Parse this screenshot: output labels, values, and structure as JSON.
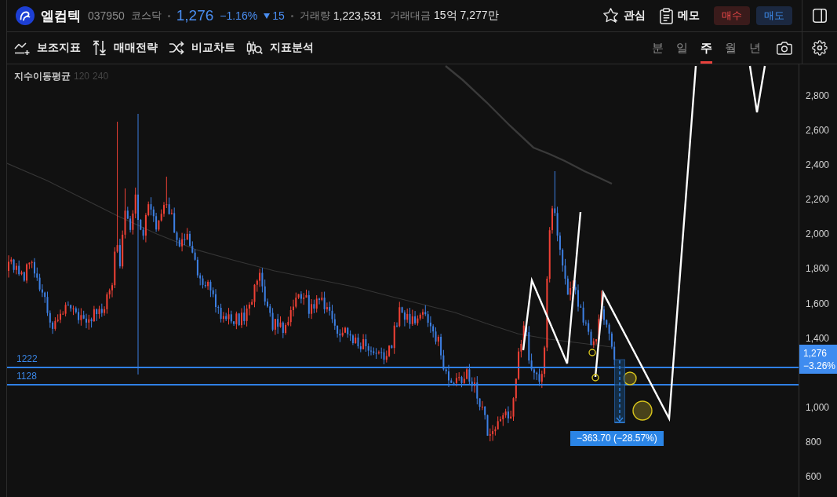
{
  "header": {
    "name": "엘컴텍",
    "code": "037950",
    "market": "코스닥",
    "price": "1,276",
    "change_percent": "−1.16%",
    "falling": true,
    "change_amount": "15",
    "volume_label": "거래량",
    "volume": "1,223,531",
    "trade_value_label": "거래대금",
    "trade_value": "15억 7,277만",
    "actions": [
      {
        "kind": "watchlist",
        "label": "관심"
      },
      {
        "kind": "memo",
        "label": "메모"
      }
    ],
    "order_buttons": [
      {
        "kind": "buy",
        "label": "매수"
      },
      {
        "kind": "sell",
        "label": "매도"
      }
    ]
  },
  "toolbar": {
    "tools": [
      {
        "kind": "indicators",
        "label": "보조지표"
      },
      {
        "kind": "strategy",
        "label": "매매전략"
      },
      {
        "kind": "compare",
        "label": "비교차트"
      },
      {
        "kind": "analysis",
        "label": "지표분석"
      }
    ],
    "timeframes": [
      {
        "label": "분",
        "selected": false
      },
      {
        "label": "일",
        "selected": false
      },
      {
        "label": "주",
        "selected": true
      },
      {
        "label": "월",
        "selected": false
      },
      {
        "label": "년",
        "selected": false
      }
    ]
  },
  "chart": {
    "legend": {
      "title": "지수이동평균",
      "periods": [
        "120",
        "240"
      ]
    },
    "levels": [
      {
        "label": "1222"
      },
      {
        "label": "1128"
      }
    ],
    "measure": {
      "label": "−363.70 (−28.57%)"
    },
    "price_axis": {
      "ticks": [
        "2,800",
        "2,600",
        "2,400",
        "2,200",
        "2,000",
        "1,800",
        "1,600",
        "1,400",
        "1,000",
        "800",
        "600"
      ]
    },
    "current_price": {
      "price": "1,276",
      "change": "−3.26%"
    }
  }
}
